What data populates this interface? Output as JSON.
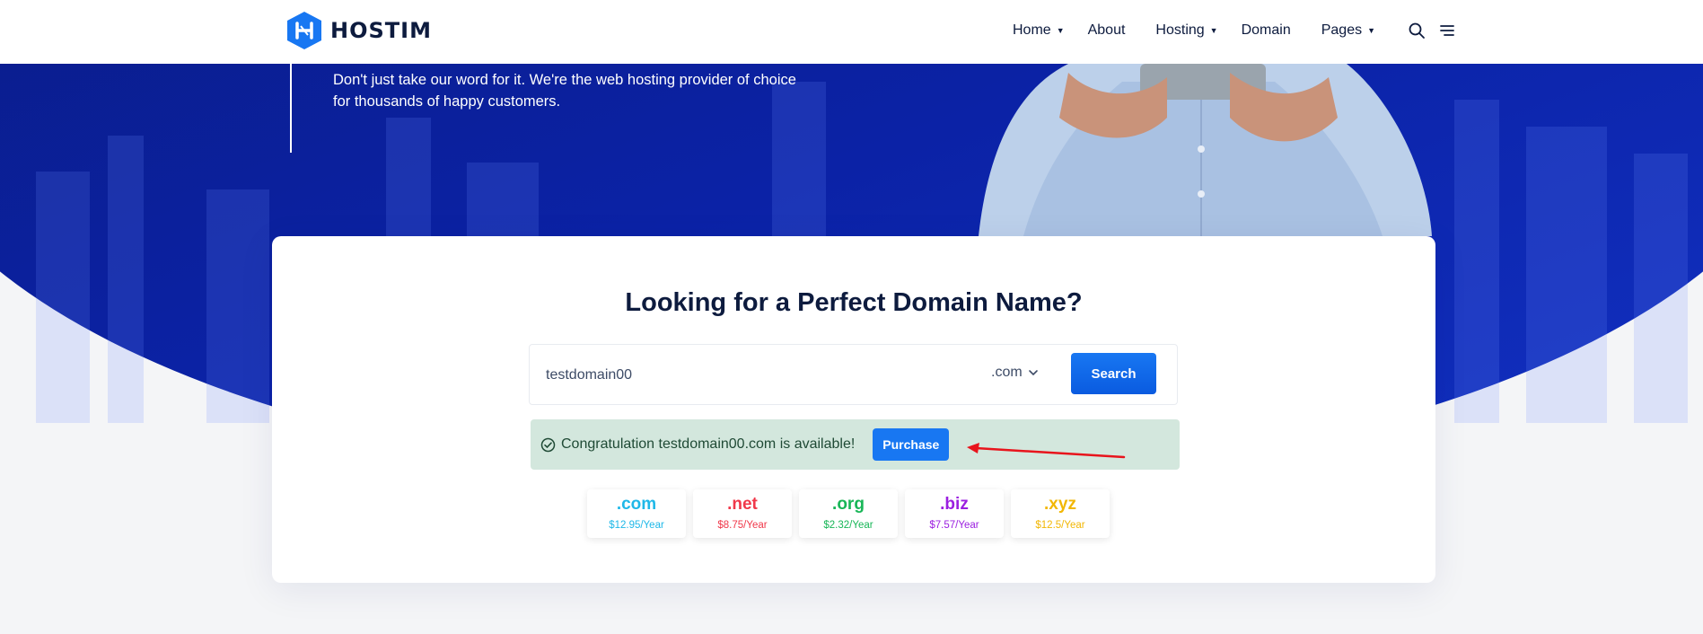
{
  "brand": {
    "name": "HOSTIM",
    "color": "#1877f2"
  },
  "nav": {
    "items": [
      {
        "label": "Home",
        "has_dropdown": true
      },
      {
        "label": "About",
        "has_dropdown": false
      },
      {
        "label": "Hosting",
        "has_dropdown": true
      },
      {
        "label": "Domain",
        "has_dropdown": false
      },
      {
        "label": "Pages",
        "has_dropdown": true
      }
    ],
    "icons": [
      "search-icon",
      "menu-icon"
    ]
  },
  "hero": {
    "quote": "Don't just take our word for it. We're the web hosting provider of choice for thousands of happy customers."
  },
  "domain_search": {
    "title": "Looking for a Perfect Domain Name?",
    "input_value": "testdomain00",
    "tld_selected": ".com",
    "search_label": "Search",
    "result_message": "Congratulation testdomain00.com is available!",
    "purchase_label": "Purchase",
    "result_color": "#d3e7dd"
  },
  "tld_prices": [
    {
      "tld": ".com",
      "price": "$12.95/Year",
      "color": "#1fb8e8"
    },
    {
      "tld": ".net",
      "price": "$8.75/Year",
      "color": "#f0384a"
    },
    {
      "tld": ".org",
      "price": "$2.32/Year",
      "color": "#18b657"
    },
    {
      "tld": ".biz",
      "price": "$7.57/Year",
      "color": "#9b1fe0"
    },
    {
      "tld": ".xyz",
      "price": "$12.5/Year",
      "color": "#f2b705"
    }
  ]
}
